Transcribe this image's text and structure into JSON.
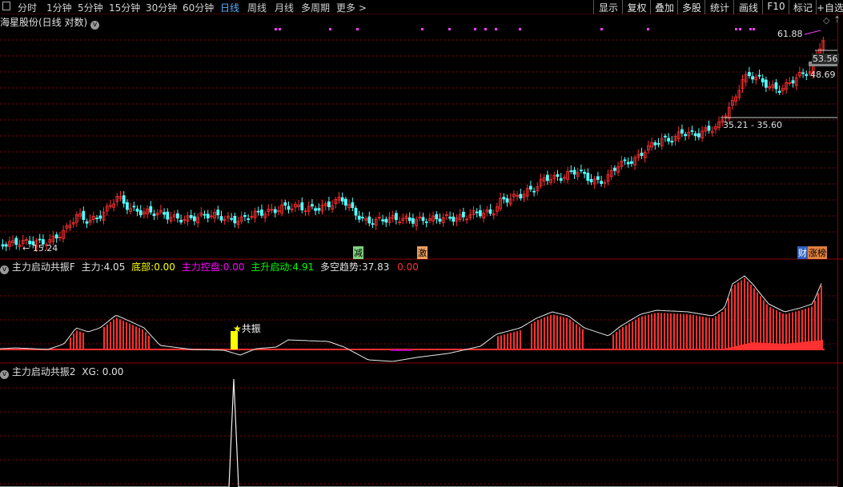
{
  "toolbar": {
    "periods": [
      "分时",
      "1分钟",
      "5分钟",
      "15分钟",
      "30分钟",
      "60分钟",
      "日线",
      "周线",
      "月线",
      "多周期",
      "更多 >"
    ],
    "active_period": "日线",
    "right_tools": [
      "显示",
      "复权",
      "叠加",
      "多股",
      "统计",
      "画线",
      "F10",
      "标记",
      "+自选"
    ]
  },
  "main_pane": {
    "title": "海星股份(日线 对数)",
    "price_labels": {
      "high": "61.88",
      "right_top": "53.56",
      "right_mid": "48.69",
      "range": "35.21 - 35.60",
      "low": "15.24"
    },
    "markers": [
      "减",
      "激"
    ],
    "badges": [
      "财",
      "涨榜"
    ]
  },
  "indicator1": {
    "name": "主力启动共振F",
    "items": [
      {
        "label": "主力:",
        "value": "4.05",
        "color": "#e0e0e0"
      },
      {
        "label": "底部:",
        "value": "0.00",
        "color": "#ffff00"
      },
      {
        "label": "主力控盘:",
        "value": "0.00",
        "color": "#ff00ff"
      },
      {
        "label": "主升启动:",
        "value": "4.91",
        "color": "#00ff00"
      },
      {
        "label": "多空趋势:",
        "value": "37.83",
        "color": "#e0e0e0"
      },
      {
        "label": "",
        "value": "0.00",
        "color": "#ff3030"
      }
    ],
    "annotation": "共振"
  },
  "indicator2": {
    "name": "主力启动共振2",
    "xg_label": "XG:",
    "xg_value": "0.00"
  },
  "colors": {
    "up": "#ff3030",
    "down": "#54ffff",
    "grid": "#8b0000",
    "accent": "#5ab0ff"
  }
}
